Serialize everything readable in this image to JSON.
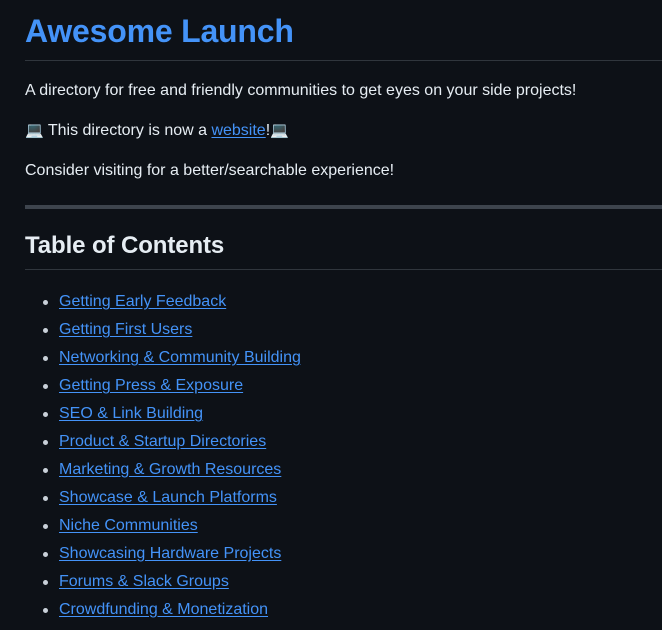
{
  "page": {
    "title": "Awesome Launch",
    "intro_paragraph": "A directory for free and friendly communities to get eyes on your side projects!",
    "website_notice": {
      "emoji_left": "💻",
      "text_before": " This directory is now a ",
      "link_label": "website",
      "text_after": "!",
      "emoji_right": "💻"
    },
    "closing_paragraph": "Consider visiting for a better/searchable experience!"
  },
  "toc": {
    "heading": "Table of Contents",
    "items": [
      {
        "label": "Getting Early Feedback"
      },
      {
        "label": "Getting First Users"
      },
      {
        "label": "Networking & Community Building"
      },
      {
        "label": "Getting Press & Exposure"
      },
      {
        "label": "SEO & Link Building"
      },
      {
        "label": "Product & Startup Directories"
      },
      {
        "label": "Marketing & Growth Resources"
      },
      {
        "label": "Showcase & Launch Platforms"
      },
      {
        "label": "Niche Communities"
      },
      {
        "label": "Showcasing Hardware Projects"
      },
      {
        "label": "Forums & Slack Groups"
      },
      {
        "label": "Crowdfunding & Monetization"
      }
    ]
  },
  "colors": {
    "background": "#0d1117",
    "text": "#e6edf3",
    "link": "#4493f8",
    "heading_accent": "#4493f8",
    "rule": "#3d444d",
    "border": "#30363d"
  }
}
